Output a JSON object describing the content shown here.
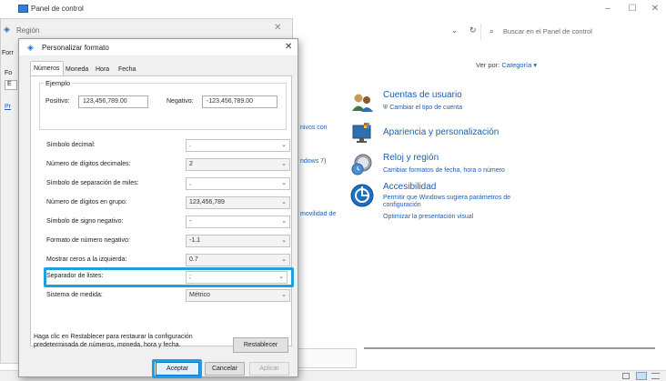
{
  "control_panel": {
    "title": "Panel de control",
    "search_placeholder": "Buscar en el Panel de control",
    "view_by_label": "Ver por:",
    "view_by_value": "Categoría ▾",
    "behind_fragments": [
      "nivos con",
      "ndows 7)",
      "movilidad de"
    ],
    "categories": [
      {
        "title": "Cuentas de usuario",
        "links": [
          "Cambiar el tipo de cuenta"
        ]
      },
      {
        "title": "Apariencia y personalización",
        "links": []
      },
      {
        "title": "Reloj y región",
        "links": [
          "Cambiar formatos de fecha, hora o número"
        ]
      },
      {
        "title": "Accesibilidad",
        "links": [
          "Permitir que Windows sugiera parámetros de configuración",
          "Optimizar la presentación visual"
        ]
      }
    ]
  },
  "region_window": {
    "title": "Región",
    "behind_fragments": [
      "Forr",
      "Fo",
      "E",
      "Pr"
    ]
  },
  "dialog": {
    "title": "Personalizar formato",
    "tabs": [
      "Números",
      "Moneda",
      "Hora",
      "Fecha"
    ],
    "example": {
      "legend": "Ejemplo",
      "positive_label": "Positivo:",
      "positive_value": "123,456,789.00",
      "negative_label": "Negativo:",
      "negative_value": "-123,456,789.00"
    },
    "settings": [
      {
        "label": "Símbolo decimal:",
        "value": "."
      },
      {
        "label": "Número de dígitos decimales:",
        "value": "2"
      },
      {
        "label": "Símbolo de separación de miles:",
        "value": ","
      },
      {
        "label": "Número de dígitos en grupo:",
        "value": "123,456,789"
      },
      {
        "label": "Símbolo de signo negativo:",
        "value": "-"
      },
      {
        "label": "Formato de número negativo:",
        "value": "-1.1"
      },
      {
        "label": "Mostrar ceros a la izquierda:",
        "value": "0.7"
      },
      {
        "label": "Separador de listes:",
        "value": ";"
      },
      {
        "label": "Sistema de medida:",
        "value": "Métrico"
      }
    ],
    "hint": "Haga clic en Restablecer para restaurar la configuración predeterminada de números, moneda, hora y fecha.",
    "reset_label": "Restablecer",
    "accept_label": "Aceptar",
    "cancel_label": "Cancelar",
    "apply_label": "Aplicar"
  },
  "colors": {
    "highlight": "#1ea0dc",
    "link": "#1a5fb4"
  }
}
